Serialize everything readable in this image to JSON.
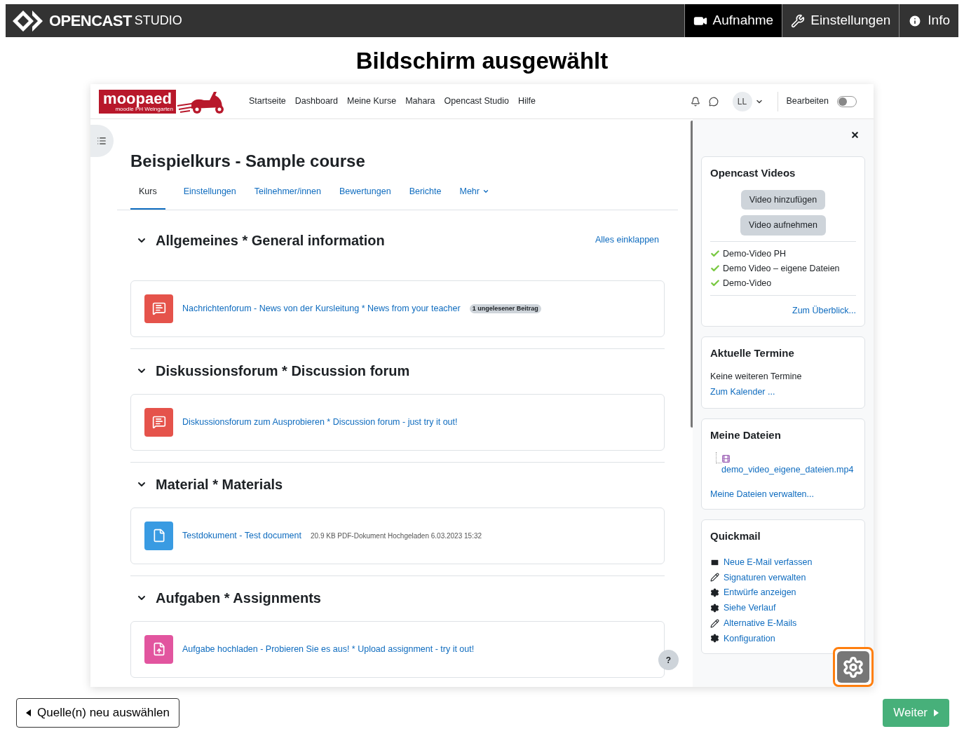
{
  "app": {
    "logo": "OPENCAST",
    "logo_sub": "STUDIO",
    "nav": [
      {
        "kind": "record",
        "label": "Aufnahme",
        "selected": true
      },
      {
        "kind": "settings",
        "label": "Einstellungen",
        "selected": false
      },
      {
        "kind": "info",
        "label": "Info",
        "selected": false
      }
    ]
  },
  "title": "Bildschirm ausgewählt",
  "preview": {
    "header": {
      "logo": "moopaed",
      "logo_sub": "moodle PH Weingarten",
      "nav": [
        "Startseite",
        "Dashboard",
        "Meine Kurse",
        "Mahara",
        "Opencast Studio",
        "Hilfe"
      ],
      "avatar": "LL",
      "edit_label": "Bearbeiten",
      "edit_on": false
    },
    "course": {
      "title": "Beispielkurs - Sample course",
      "tabs": [
        {
          "label": "Kurs",
          "selected": true
        },
        {
          "label": "Einstellungen",
          "selected": false
        },
        {
          "label": "Teilnehmer/innen",
          "selected": false
        },
        {
          "label": "Bewertungen",
          "selected": false
        },
        {
          "label": "Berichte",
          "selected": false
        },
        {
          "label": "Mehr",
          "selected": false,
          "dropdown": true
        }
      ],
      "collapse_link": "Alles einklappen",
      "sections": [
        {
          "title": "Allgemeines * General information",
          "expanded": true,
          "activities": [
            {
              "kind": "forum",
              "title": "Nachrichtenforum - News von der Kursleitung * News from your teacher",
              "badge": "1 ungelesener Beitrag"
            }
          ]
        },
        {
          "title": "Diskussionsforum * Discussion forum",
          "expanded": true,
          "activities": [
            {
              "kind": "forum",
              "title": "Diskussionsforum zum Ausprobieren * Discussion forum - just try it out!"
            }
          ]
        },
        {
          "title": "Material * Materials",
          "expanded": true,
          "activities": [
            {
              "kind": "file",
              "title": "Testdokument - Test document",
              "meta": "20.9 KB PDF-Dokument Hochgeladen 6.03.2023 15:32"
            }
          ]
        },
        {
          "title": "Aufgaben * Assignments",
          "expanded": true,
          "activities": [
            {
              "kind": "assign",
              "title": "Aufgabe hochladen - Probieren Sie es aus! * Upload assignment - try it out!"
            }
          ]
        }
      ],
      "help": "?"
    },
    "drawer": {
      "blocks": [
        {
          "kind": "opencast",
          "title": "Opencast Videos",
          "buttons": [
            "Video hinzufügen",
            "Video aufnehmen"
          ],
          "videos": [
            "Demo-Video PH",
            "Demo Video – eigene Dateien",
            "Demo-Video"
          ],
          "link": "Zum Überblick..."
        },
        {
          "kind": "events",
          "title": "Aktuelle Termine",
          "text": "Keine weiteren Termine",
          "link": "Zum Kalender ..."
        },
        {
          "kind": "files",
          "title": "Meine Dateien",
          "file": "demo_video_eigene_dateien.mp4",
          "link": "Meine Dateien verwalten..."
        },
        {
          "kind": "quickmail",
          "title": "Quickmail",
          "links": [
            {
              "kind": "mail",
              "label": "Neue E-Mail verfassen"
            },
            {
              "kind": "edit",
              "label": "Signaturen verwalten"
            },
            {
              "kind": "drafts",
              "label": "Entwürfe anzeigen"
            },
            {
              "kind": "history",
              "label": "Siehe Verlauf"
            },
            {
              "kind": "edit",
              "label": "Alternative E-Mails"
            },
            {
              "kind": "config",
              "label": "Konfiguration"
            }
          ]
        }
      ]
    }
  },
  "footer": {
    "back": "Quelle(n) neu auswählen",
    "next": "Weiter"
  }
}
